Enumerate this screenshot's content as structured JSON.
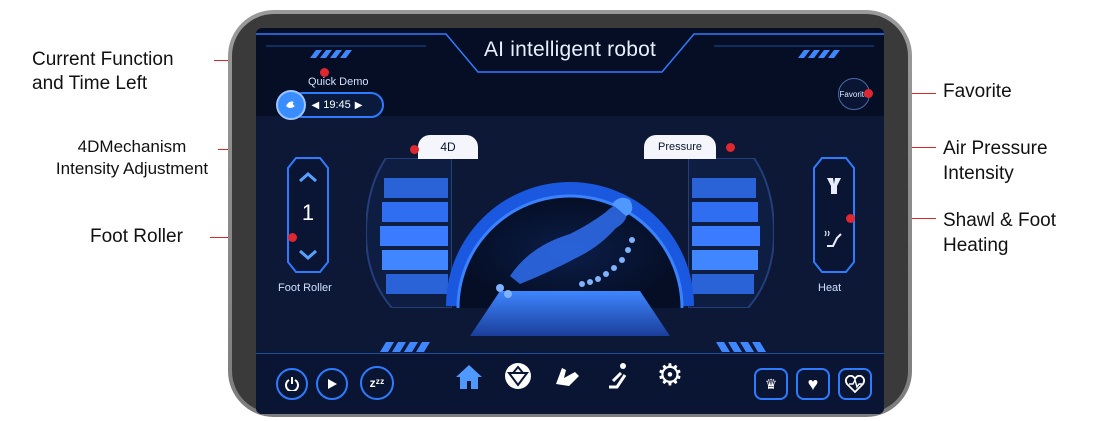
{
  "callouts": {
    "current_function_line1": "Current Function",
    "current_function_line2": "and Time Left",
    "mechanism_line1": "4DMechanism",
    "mechanism_line2": "Intensity Adjustment",
    "foot_roller": "Foot Roller",
    "favorite": "Favorite",
    "air_pressure_line1": "Air Pressure",
    "air_pressure_line2": "Intensity",
    "shawl_line1": "Shawl & Foot",
    "shawl_line2": "Heating"
  },
  "screen": {
    "title": "AI intelligent robot",
    "mode_label": "Quick Demo",
    "time_left": "19:45",
    "favorite_button": "Favorite",
    "tab_4d": "4D",
    "tab_pressure": "Pressure",
    "foot_roller_value": "1",
    "foot_roller_label": "Foot Roller",
    "heat_label": "Heat"
  },
  "icons": {
    "bottom_left": [
      "power-icon",
      "play-icon",
      "sleep-icon"
    ],
    "center": [
      "home-icon",
      "ball-icon",
      "hand-massage-icon",
      "recline-icon",
      "gear-icon"
    ],
    "bottom_right": [
      "vip-icon",
      "heart-icon",
      "health-icon"
    ]
  },
  "colors": {
    "accent": "#2f7bff",
    "callout_red": "#e0262e",
    "screen_bg": "#050e24",
    "home_active": "#4f98ff"
  }
}
